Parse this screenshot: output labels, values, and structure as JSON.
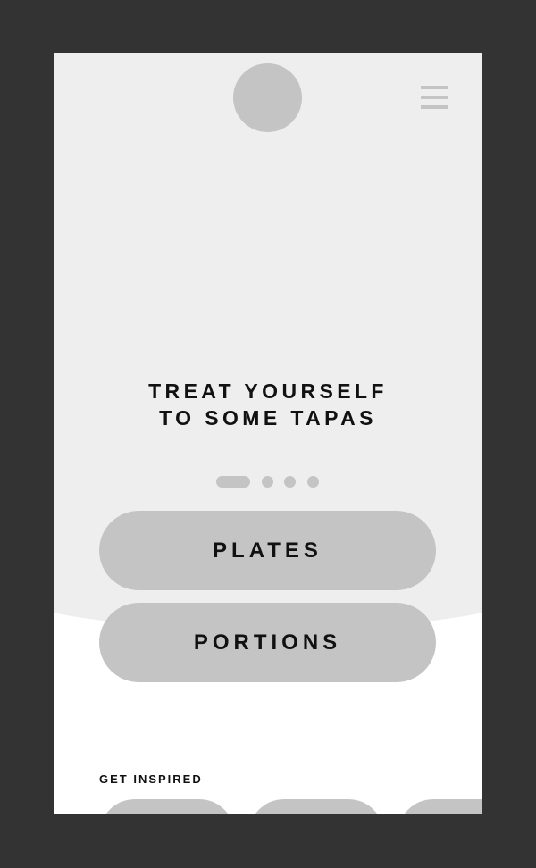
{
  "hero": {
    "headline_line1": "TREAT YOURSELF",
    "headline_line2": "TO SOME TAPAS",
    "carousel_slide_count": 4,
    "carousel_active_index": 0
  },
  "buttons": {
    "plates_label": "PLATES",
    "portions_label": "PORTIONS"
  },
  "inspired": {
    "label": "GET INSPIRED"
  },
  "icons": {
    "menu": "hamburger-menu-icon",
    "logo": "logo-placeholder"
  },
  "colors": {
    "background": "#333333",
    "hero": "#eeeeee",
    "placeholder": "#c4c4c4",
    "text": "#111111"
  }
}
